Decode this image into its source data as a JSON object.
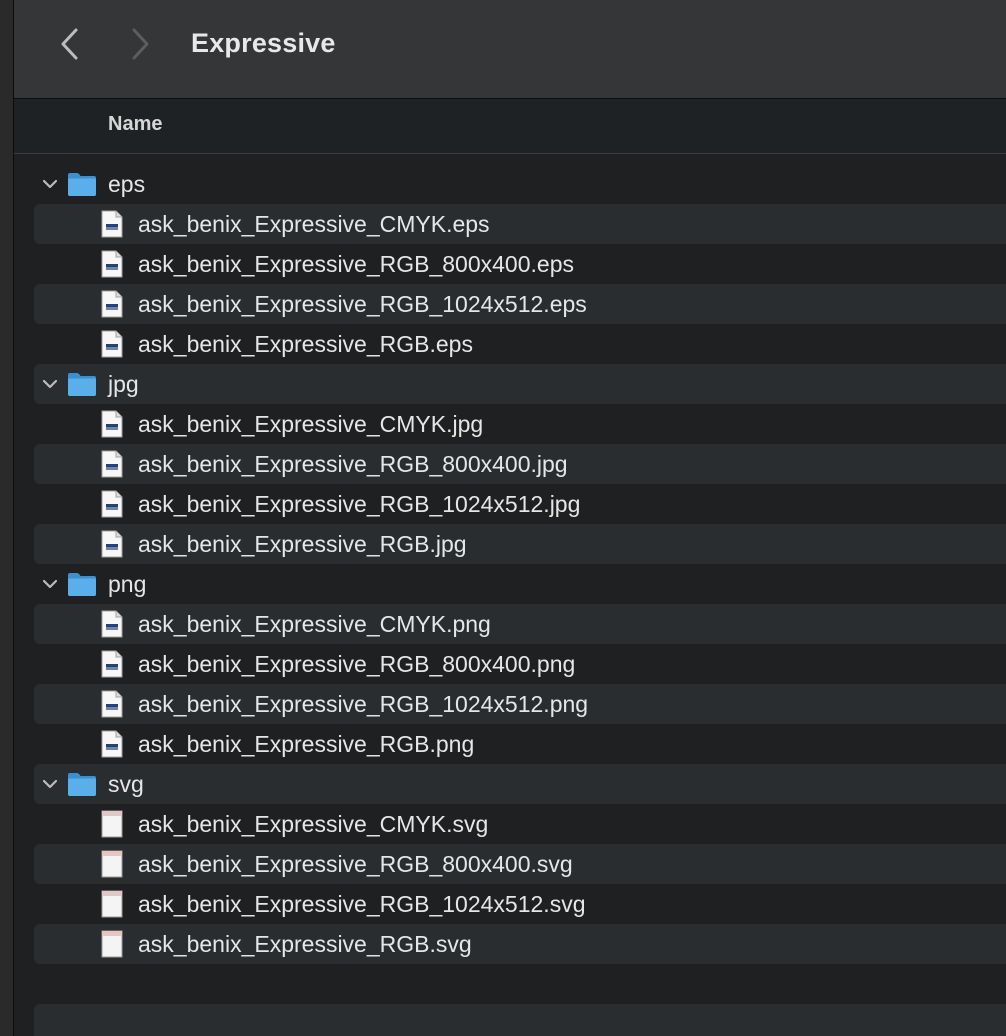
{
  "window": {
    "title": "Expressive"
  },
  "toolbar": {
    "back_icon": "chevron-left-icon",
    "forward_icon": "chevron-right-icon"
  },
  "columns": {
    "name": "Name"
  },
  "colors": {
    "folder": "#5aaeea",
    "background": "#1e2022",
    "alt_row": "#2a2d2f",
    "titlebar": "#343637"
  },
  "folders": [
    {
      "name": "eps",
      "expanded": true,
      "file_icon": "eps-file-icon",
      "files": [
        "ask_benix_Expressive_CMYK.eps",
        "ask_benix_Expressive_RGB_800x400.eps",
        "ask_benix_Expressive_RGB_1024x512.eps",
        "ask_benix_Expressive_RGB.eps"
      ]
    },
    {
      "name": "jpg",
      "expanded": true,
      "file_icon": "jpg-file-icon",
      "files": [
        "ask_benix_Expressive_CMYK.jpg",
        "ask_benix_Expressive_RGB_800x400.jpg",
        "ask_benix_Expressive_RGB_1024x512.jpg",
        "ask_benix_Expressive_RGB.jpg"
      ]
    },
    {
      "name": "png",
      "expanded": true,
      "file_icon": "png-file-icon",
      "files": [
        "ask_benix_Expressive_CMYK.png",
        "ask_benix_Expressive_RGB_800x400.png",
        "ask_benix_Expressive_RGB_1024x512.png",
        "ask_benix_Expressive_RGB.png"
      ]
    },
    {
      "name": "svg",
      "expanded": true,
      "file_icon": "svg-file-icon",
      "files": [
        "ask_benix_Expressive_CMYK.svg",
        "ask_benix_Expressive_RGB_800x400.svg",
        "ask_benix_Expressive_RGB_1024x512.svg",
        "ask_benix_Expressive_RGB.svg"
      ]
    }
  ]
}
